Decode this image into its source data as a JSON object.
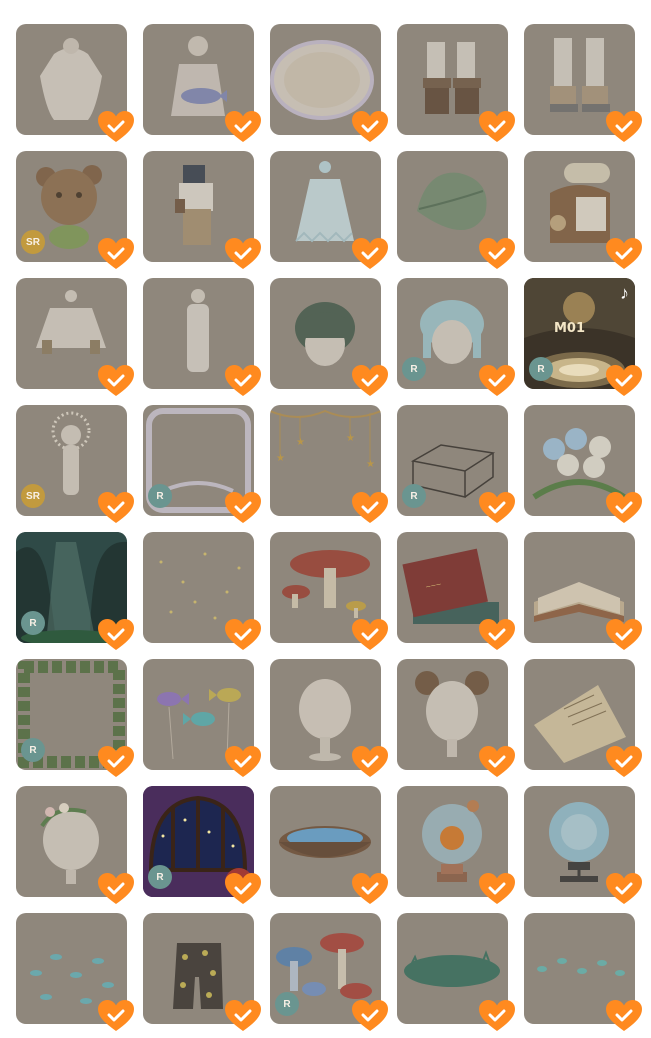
{
  "colors": {
    "heart": "#ff8a1f",
    "check": "#ffffff",
    "tile_dim": "#8f877c",
    "rarity_sr": "#c29a3e",
    "rarity_r": "#6a9590"
  },
  "items": [
    {
      "icon": "white-blouse-icon",
      "rarity": "",
      "badge": "",
      "highlight": false
    },
    {
      "icon": "fish-bag-outfit-icon",
      "rarity": "",
      "badge": "",
      "highlight": false
    },
    {
      "icon": "oval-mirror-frame-icon",
      "rarity": "",
      "badge": "",
      "highlight": false
    },
    {
      "icon": "brown-boots-icon",
      "rarity": "",
      "badge": "",
      "highlight": false
    },
    {
      "icon": "leg-warmer-boots-icon",
      "rarity": "",
      "badge": "",
      "highlight": false
    },
    {
      "icon": "cookie-bear-costume-icon",
      "rarity": "SR",
      "badge": "",
      "highlight": false
    },
    {
      "icon": "explorer-outfit-icon",
      "rarity": "",
      "badge": "",
      "highlight": false
    },
    {
      "icon": "ghost-dress-icon",
      "rarity": "",
      "badge": "",
      "highlight": false
    },
    {
      "icon": "big-leaf-icon",
      "rarity": "",
      "badge": "",
      "highlight": false
    },
    {
      "icon": "travel-backpack-icon",
      "rarity": "",
      "badge": "",
      "highlight": false
    },
    {
      "icon": "sweater-icon",
      "rarity": "",
      "badge": "",
      "highlight": false
    },
    {
      "icon": "bodysuit-icon",
      "rarity": "",
      "badge": "",
      "highlight": false
    },
    {
      "icon": "green-hair-icon",
      "rarity": "",
      "badge": "",
      "highlight": false
    },
    {
      "icon": "blue-braids-hair-icon",
      "rarity": "R",
      "badge": "",
      "highlight": false
    },
    {
      "icon": "m01-music-stage-icon",
      "rarity": "R",
      "badge": "M01",
      "highlight": true
    },
    {
      "icon": "halo-body-icon",
      "rarity": "SR",
      "badge": "",
      "highlight": false
    },
    {
      "icon": "lace-frame-icon",
      "rarity": "R",
      "badge": "",
      "highlight": false
    },
    {
      "icon": "hanging-stars-icon",
      "rarity": "",
      "badge": "",
      "highlight": false
    },
    {
      "icon": "glass-box-icon",
      "rarity": "R",
      "badge": "",
      "highlight": false
    },
    {
      "icon": "rose-bouquet-icon",
      "rarity": "",
      "badge": "",
      "highlight": false
    },
    {
      "icon": "forest-background-icon",
      "rarity": "R",
      "badge": "",
      "highlight": true
    },
    {
      "icon": "fireflies-icon",
      "rarity": "",
      "badge": "",
      "highlight": false
    },
    {
      "icon": "mushrooms-icon",
      "rarity": "",
      "badge": "",
      "highlight": false
    },
    {
      "icon": "red-book-stack-icon",
      "rarity": "",
      "badge": "",
      "highlight": false
    },
    {
      "icon": "open-book-icon",
      "rarity": "",
      "badge": "",
      "highlight": false
    },
    {
      "icon": "leaf-wreath-frame-icon",
      "rarity": "R",
      "badge": "",
      "highlight": false
    },
    {
      "icon": "fish-balloons-icon",
      "rarity": "",
      "badge": "",
      "highlight": false
    },
    {
      "icon": "head-base-icon",
      "rarity": "",
      "badge": "",
      "highlight": false
    },
    {
      "icon": "bear-ears-icon",
      "rarity": "",
      "badge": "",
      "highlight": false
    },
    {
      "icon": "letter-paper-icon",
      "rarity": "",
      "badge": "",
      "highlight": false
    },
    {
      "icon": "flower-vine-headpiece-icon",
      "rarity": "",
      "badge": "",
      "highlight": false
    },
    {
      "icon": "shell-night-window-icon",
      "rarity": "R",
      "badge": "",
      "highlight": true
    },
    {
      "icon": "water-basin-icon",
      "rarity": "",
      "badge": "",
      "highlight": false
    },
    {
      "icon": "pumpkin-crystal-ball-icon",
      "rarity": "",
      "badge": "",
      "highlight": false
    },
    {
      "icon": "blue-crystal-ball-icon",
      "rarity": "",
      "badge": "",
      "highlight": false
    },
    {
      "icon": "fish-school-icon",
      "rarity": "",
      "badge": "",
      "highlight": false
    },
    {
      "icon": "polka-dot-overalls-icon",
      "rarity": "",
      "badge": "",
      "highlight": false
    },
    {
      "icon": "blue-mushrooms-icon",
      "rarity": "R",
      "badge": "",
      "highlight": false
    },
    {
      "icon": "grass-island-icon",
      "rarity": "",
      "badge": "",
      "highlight": false
    },
    {
      "icon": "footprints-icon",
      "rarity": "",
      "badge": "",
      "highlight": false
    }
  ]
}
